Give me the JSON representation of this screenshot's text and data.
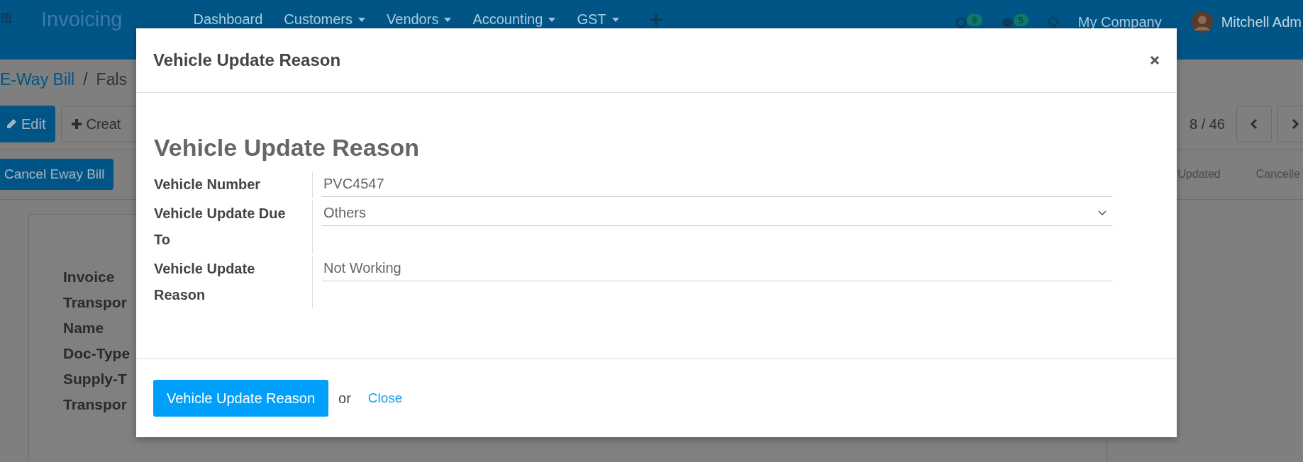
{
  "app_bar": {
    "app_name": "Invoicing",
    "menu": [
      {
        "label": "Dashboard",
        "dropdown": false
      },
      {
        "label": "Customers",
        "dropdown": true
      },
      {
        "label": "Vendors",
        "dropdown": true
      },
      {
        "label": "Accounting",
        "dropdown": true
      },
      {
        "label": "GST",
        "dropdown": true
      }
    ],
    "activity_count": "8",
    "message_count": "5",
    "company": "My Company",
    "user": "Mitchell Adm"
  },
  "breadcrumb": [
    "E-Way Bill",
    "/",
    "Fals"
  ],
  "buttons": [
    {
      "label": "Edit",
      "kind": "primary"
    },
    {
      "label": "Creat",
      "kind": "secondary"
    }
  ],
  "pager": "8 / 46",
  "action_button": "Cancel Eway Bill",
  "statusbar": [
    "Updated",
    "Cancelle"
  ],
  "sheet_labels": [
    "Invoice",
    "Transpor",
    "Name",
    "Doc-Type",
    "Supply-T",
    "Transpor"
  ],
  "dialog": {
    "title": "Vehicle Update Reason",
    "heading": "Vehicle Update Reason",
    "fields": [
      {
        "label": "Vehicle Number",
        "value": "PVC4547",
        "kind": "text"
      },
      {
        "label": "Vehicle Update Due To",
        "value": "Others",
        "kind": "select"
      },
      {
        "label": "Vehicle Update Reason",
        "value": "Not Working",
        "kind": "text"
      }
    ],
    "confirm": "Vehicle Update Reason",
    "or": "or",
    "close": "Close"
  }
}
